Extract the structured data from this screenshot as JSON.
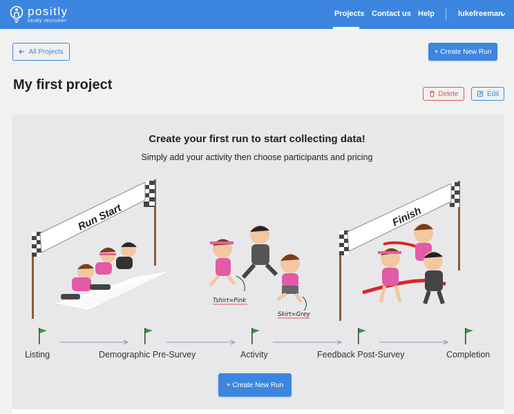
{
  "nav": {
    "logo_name": "positly",
    "logo_sub": "study recruiter",
    "projects": "Projects",
    "contact": "Contact us",
    "help": "Help",
    "user": "lukefreeman"
  },
  "toolbar": {
    "all_projects": "All Projects",
    "create_run_top": "+ Create New Run"
  },
  "project": {
    "title": "My first project",
    "delete": "Delete",
    "edit": "Edit"
  },
  "empty_state": {
    "heading": "Create your first run to start collecting data!",
    "subheading": "Simply add your activity then choose participants and pricing",
    "banner_start": "Run Start",
    "banner_finish": "Finish",
    "note_pink": "Tshirt=Pink",
    "note_grey": "Skirt=Grey",
    "create_run_bottom": "+ Create New Run"
  },
  "steps": [
    {
      "label": "Listing"
    },
    {
      "label": "Demographic Pre-Survey"
    },
    {
      "label": "Activity"
    },
    {
      "label": "Feedback Post-Survey"
    },
    {
      "label": "Completion"
    }
  ],
  "colors": {
    "brand": "#3c86e0",
    "danger": "#d9534f",
    "flag_green": "#2e9b3a",
    "pink": "#e25ba6",
    "ribbon_red": "#d8262a"
  },
  "icons": {
    "back": "arrow-left-icon",
    "delete": "trash-icon",
    "edit": "edit-icon",
    "user_menu": "chevron-down-icon",
    "logo": "lightbulb-person-icon"
  }
}
